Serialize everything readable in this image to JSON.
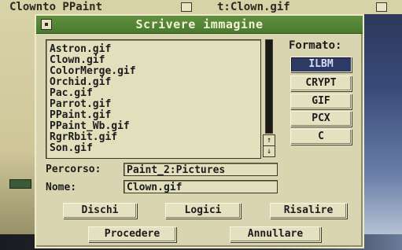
{
  "background": {
    "title_left": "Clownto PPaint",
    "title_right": "t:Clown.gif"
  },
  "dialog": {
    "title": "Scrivere immagine",
    "files": [
      "Astron.gif",
      "Clown.gif",
      "ColorMerge.gif",
      "Orchid.gif",
      "Pac.gif",
      "Parrot.gif",
      "PPaint.gif",
      "PPaint_Wb.gif",
      "RgrRbit.gif",
      "Son.gif"
    ],
    "scroll_up": "↑",
    "scroll_down": "↓",
    "format_label": "Formato:",
    "formats": [
      "ILBM",
      "CRYPT",
      "GIF",
      "PCX",
      "C"
    ],
    "selected_format": "ILBM",
    "path_label": "Percorso:",
    "path_value": "Paint_2:Pictures",
    "name_label": "Nome:",
    "name_value": "Clown.gif",
    "buttons": {
      "disks": "Dischi",
      "logical": "Logici",
      "parent": "Risalire",
      "proceed": "Procedere",
      "cancel": "Annullare"
    }
  }
}
